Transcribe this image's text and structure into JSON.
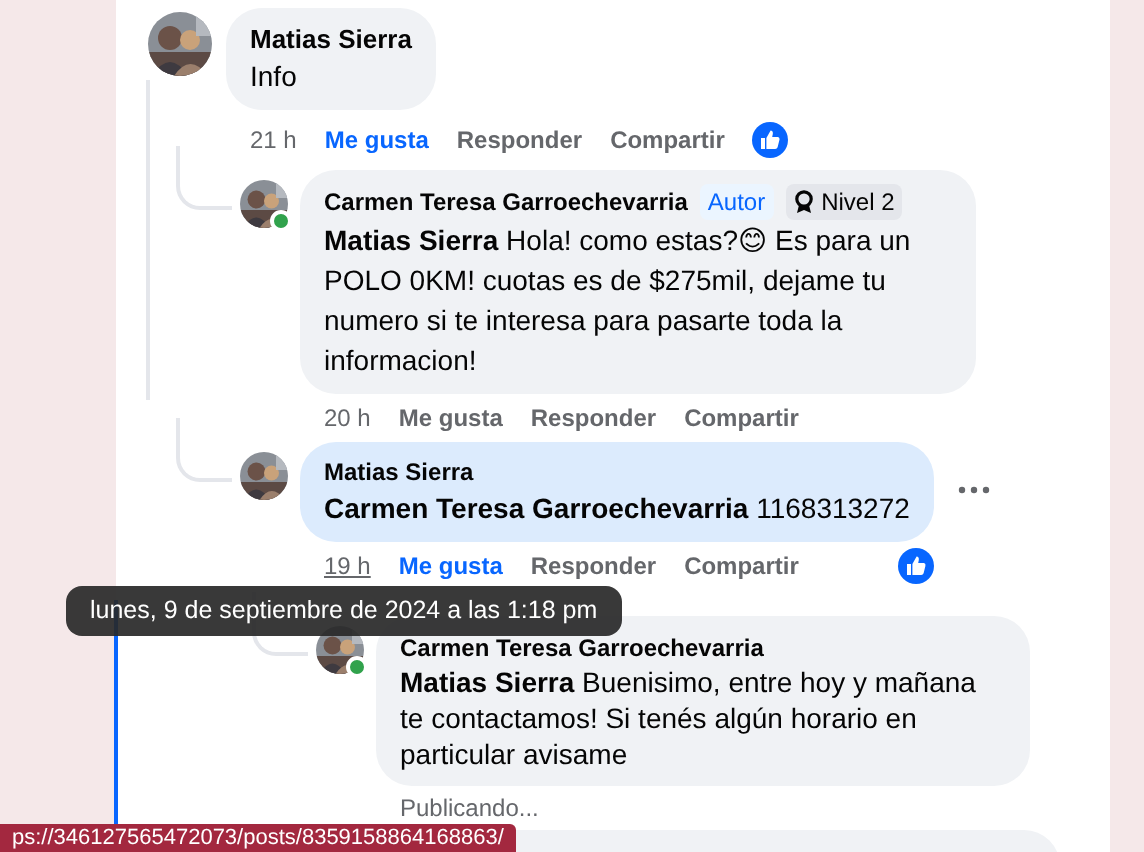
{
  "comment": {
    "author": "Matias Sierra",
    "text": "Info",
    "online": false,
    "highlighted": false,
    "time": "21 h",
    "time_hovered": false,
    "like_selected": true,
    "actions": [
      "Me gusta",
      "Responder",
      "Compartir"
    ],
    "has_reaction": true,
    "show_menu": false,
    "replies": [
      {
        "author": "Carmen Teresa Garroechevarria",
        "badges": [
          {
            "kind": "role",
            "label": "Autor"
          },
          {
            "kind": "level",
            "label": "Nivel 2"
          }
        ],
        "text": "**Matias Sierra** Hola! como estas?😊 Es para un POLO 0KM! cuotas es de $275mil, dejame tu numero si te interesa para pasarte toda la informacion!",
        "online": true,
        "highlighted": false,
        "time": "20 h",
        "time_hovered": false,
        "like_selected": false,
        "actions": [
          "Me gusta",
          "Responder",
          "Compartir"
        ],
        "has_reaction": false,
        "show_menu": false
      },
      {
        "author": "Matias Sierra",
        "text": "**Carmen Teresa Garroechevarria** 1168313272",
        "online": false,
        "highlighted": true,
        "time": "19 h",
        "time_hovered": true,
        "like_selected": true,
        "actions": [
          "Me gusta",
          "Responder",
          "Compartir"
        ],
        "has_reaction": true,
        "show_menu": true,
        "replies": [
          {
            "author": "Carmen Teresa Garroechevarria",
            "text": "**Matias Sierra** Buenisimo, entre hoy y mañana te contactamos! Si tenés algún horario en particular avisame",
            "online": true,
            "highlighted": false,
            "status": "Publicando...",
            "show_menu": false
          }
        ]
      }
    ]
  },
  "tooltip": {
    "text": "lunes, 9 de septiembre de 2024 a las 1:18 pm"
  },
  "status_bar": {
    "url": "ps://346127565472073/posts/8359158864168863/"
  }
}
